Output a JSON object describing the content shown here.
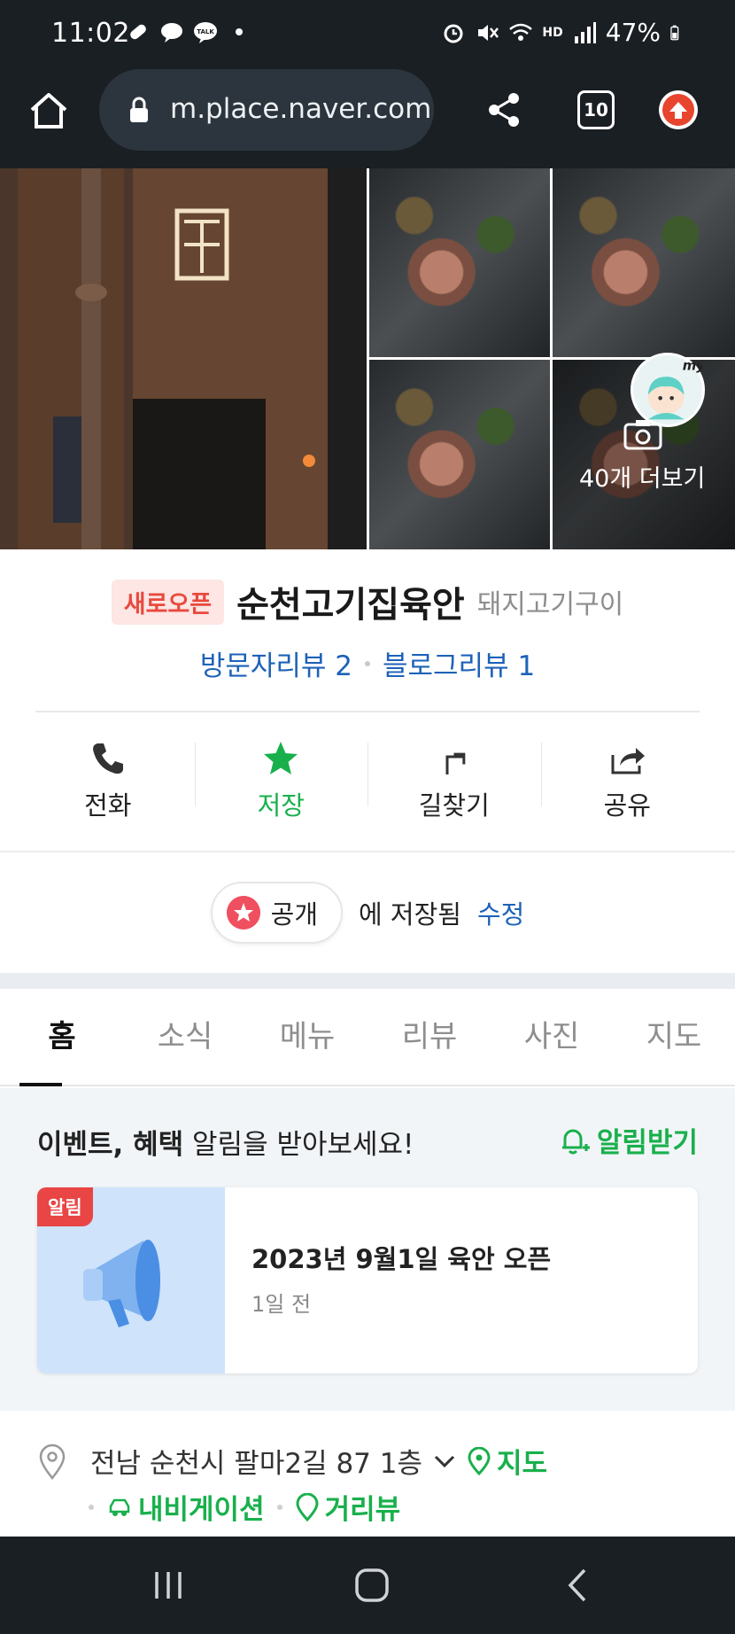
{
  "status": {
    "time": "11:02",
    "battery": "47%",
    "hd_label": "HD"
  },
  "browser": {
    "url": "m.place.naver.com",
    "tab_count": "10"
  },
  "gallery": {
    "more_label": "40개 더보기",
    "avatar_label": "my"
  },
  "place": {
    "badge": "새로오픈",
    "name": "순천고기집육안",
    "category": "돼지고기구이",
    "visitor_reviews": "방문자리뷰 2",
    "blog_reviews": "블로그리뷰 1"
  },
  "actions": [
    {
      "label": "전화",
      "icon": "phone-icon"
    },
    {
      "label": "저장",
      "icon": "star-icon"
    },
    {
      "label": "길찾기",
      "icon": "directions-icon"
    },
    {
      "label": "공유",
      "icon": "share-icon"
    }
  ],
  "saved": {
    "pill_label": "공개",
    "text": "에 저장됨",
    "edit": "수정"
  },
  "tabs": [
    "홈",
    "소식",
    "메뉴",
    "리뷰",
    "사진",
    "지도"
  ],
  "notice": {
    "heading_bold": "이벤트, 혜택",
    "heading_rest": " 알림을 받아보세요!",
    "alarm_label": "알림받기",
    "card_badge": "알림",
    "card_title": "2023년 9월1일 육안 오픈",
    "card_time": "1일 전"
  },
  "address": {
    "text": "전남 순천시 팔마2길 87 1층",
    "map_link": "지도",
    "navigation_link": "내비게이션",
    "streetview_link": "거리뷰"
  },
  "colors": {
    "green": "#19b04c",
    "blue_link": "#1e62b8",
    "badge_red": "#e8493d",
    "dark_bar": "#1a1f24"
  }
}
